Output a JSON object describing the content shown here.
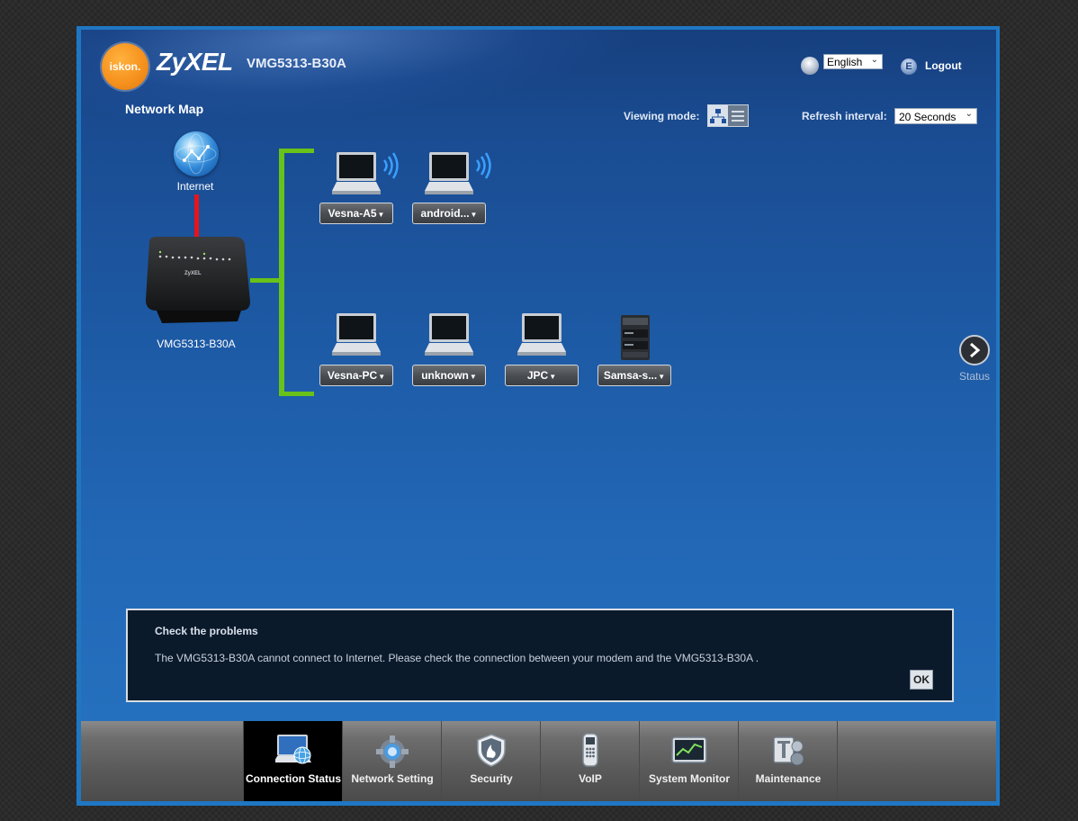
{
  "header": {
    "isp_logo_text": "iskon.",
    "brand_logo_text": "ZyXEL",
    "model": "VMG5313-B30A",
    "language": "English",
    "logout_label": "Logout"
  },
  "page": {
    "title": "Network Map",
    "viewing_mode_label": "Viewing mode:",
    "viewing_mode": "map",
    "refresh_label": "Refresh interval:",
    "refresh_value": "20 Seconds"
  },
  "map": {
    "internet_label": "Internet",
    "router_label": "VMG5313-B30A",
    "wan_status_color": "#e8141a",
    "lan_color": "#68c21a",
    "wireless_devices": [
      {
        "name": "Vesna-A5",
        "type": "laptop-wireless"
      },
      {
        "name": "android...",
        "type": "laptop-wireless"
      }
    ],
    "wired_devices": [
      {
        "name": "Vesna-PC",
        "type": "laptop"
      },
      {
        "name": "unknown",
        "type": "laptop"
      },
      {
        "name": "JPC",
        "type": "laptop"
      },
      {
        "name": "Samsa-s...",
        "type": "server"
      }
    ],
    "status_label": "Status"
  },
  "dialog": {
    "title": "Check the problems",
    "message": "The VMG5313-B30A cannot connect to Internet. Please check the connection between your modem and the VMG5313-B30A .",
    "ok_label": "OK"
  },
  "nav": {
    "items": [
      {
        "label": "Connection Status",
        "icon": "connection-status-icon",
        "active": true
      },
      {
        "label": "Network Setting",
        "icon": "network-setting-icon",
        "active": false
      },
      {
        "label": "Security",
        "icon": "security-icon",
        "active": false
      },
      {
        "label": "VoIP",
        "icon": "voip-icon",
        "active": false
      },
      {
        "label": "System Monitor",
        "icon": "system-monitor-icon",
        "active": false
      },
      {
        "label": "Maintenance",
        "icon": "maintenance-icon",
        "active": false
      }
    ]
  }
}
